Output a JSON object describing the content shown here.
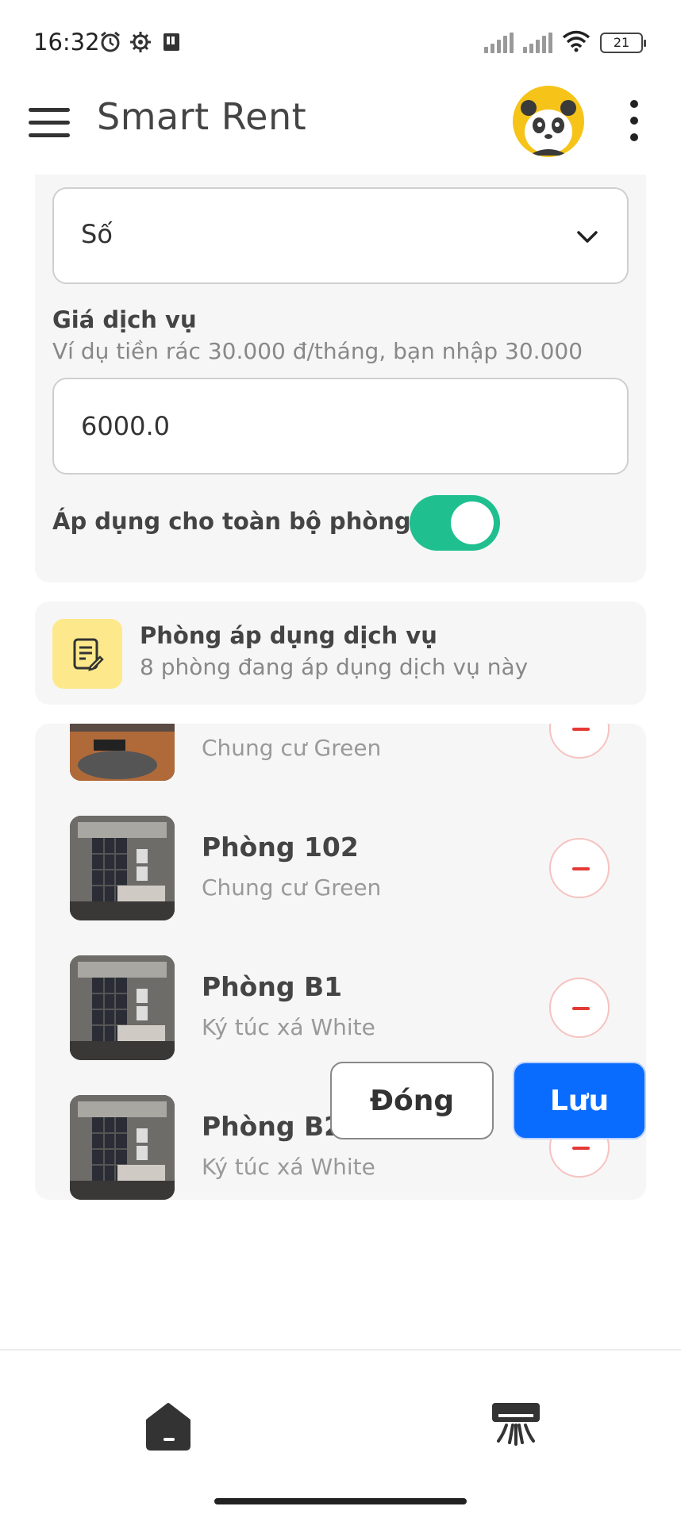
{
  "status_bar": {
    "time": "16:32",
    "battery": "21"
  },
  "app_bar": {
    "title": "Smart Rent"
  },
  "form": {
    "unit_select_value": "Số",
    "price_label": "Giá dịch vụ",
    "price_hint": "Ví dụ tiền rác 30.000 đ/tháng, bạn nhập 30.000",
    "price_value": "6000.0",
    "apply_all_label": "Áp dụng cho toàn bộ phòng",
    "apply_all_on": true
  },
  "rooms_header": {
    "title": "Phòng áp dụng dịch vụ",
    "subtitle": "8 phòng đang áp dụng dịch vụ này"
  },
  "rooms": [
    {
      "name": "",
      "building": "Chung cư Green"
    },
    {
      "name": "Phòng 102",
      "building": "Chung cư Green"
    },
    {
      "name": "Phòng B1",
      "building": "Ký túc xá White"
    },
    {
      "name": "Phòng B2",
      "building": "Ký túc xá White"
    }
  ],
  "actions": {
    "close_label": "Đóng",
    "save_label": "Lưu"
  },
  "colors": {
    "toggle_on": "#1fbf8f",
    "primary": "#0a6cff",
    "remove": "#e53935",
    "note_icon_bg": "#fde98b"
  },
  "icons": {
    "bottom_nav": [
      "home-icon",
      "air-conditioner-icon"
    ]
  }
}
